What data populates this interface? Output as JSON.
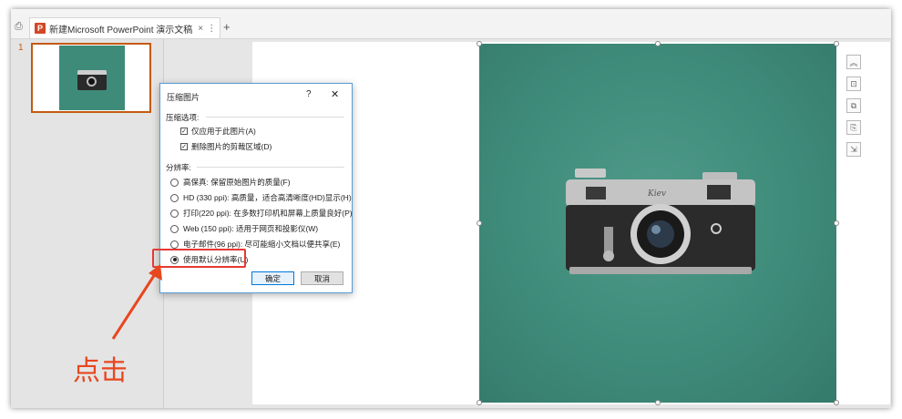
{
  "tabbar": {
    "tab_title": "新建Microsoft PowerPoint 演示文稿",
    "close_glyph": "×",
    "more_glyph": "⋮",
    "add_glyph": "+",
    "app_icon_letter": "P"
  },
  "thumbnails": {
    "slide_number": "1"
  },
  "side_tools": [
    "collapse-icon",
    "crop-frame-icon",
    "layer-icon",
    "copy-format-icon",
    "resize-icon"
  ],
  "dialog": {
    "title": "压缩图片",
    "help": "?",
    "close": "✕",
    "compress_section": "压缩选项:",
    "checkboxes": [
      {
        "label": "仅应用于此图片(A)",
        "checked": true
      },
      {
        "label": "删除图片的剪裁区域(D)",
        "checked": true
      }
    ],
    "resolution_section": "分辨率:",
    "options": [
      {
        "label": "高保真: 保留原始图片的质量(F)",
        "selected": false
      },
      {
        "label": "HD (330 ppi): 高质量，适合高清晰度(HD)显示(H)",
        "selected": false
      },
      {
        "label": "打印(220 ppi): 在多数打印机和屏幕上质量良好(P)",
        "selected": false
      },
      {
        "label": "Web (150 ppi): 适用于网页和投影仪(W)",
        "selected": false
      },
      {
        "label": "电子邮件(96 ppi): 尽可能缩小文档以便共享(E)",
        "selected": false
      },
      {
        "label": "使用默认分辨率(U)",
        "selected": true
      }
    ],
    "ok_label": "确定",
    "cancel_label": "取消"
  },
  "annotation": {
    "text": "点击",
    "color": "#e8461e"
  },
  "colors": {
    "accent": "#c55a11",
    "photo_bg": "#3f8b7a",
    "highlight": "#e53935",
    "dialog_border": "#5b9bd5"
  }
}
